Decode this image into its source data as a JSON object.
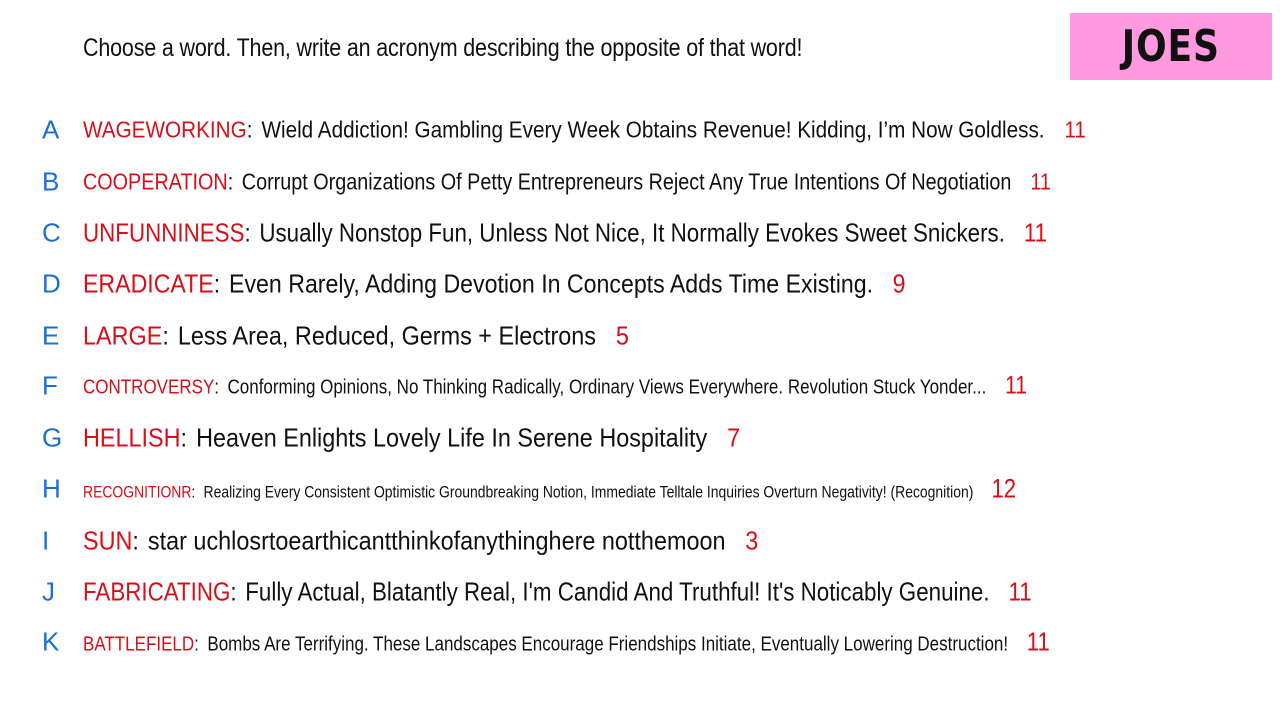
{
  "prompt": "Choose a word. Then, write an acronym describing the opposite of that word!",
  "team": "JOES",
  "rows": [
    {
      "letter": "A",
      "word": "WAGEWORKING",
      "acronym": "Wield Addiction! Gambling Every Week Obtains Revenue! Kidding, I’m Now Goldless.",
      "score": "11"
    },
    {
      "letter": "B",
      "word": "COOPERATION",
      "acronym": "Corrupt Organizations Of Petty Entrepreneurs Reject Any True Intentions Of Negotiation",
      "score": "11"
    },
    {
      "letter": "C",
      "word": "UNFUNNINESS",
      "acronym": "Usually Nonstop Fun, Unless Not Nice, It Normally Evokes Sweet Snickers.",
      "score": "11"
    },
    {
      "letter": "D",
      "word": "ERADICATE",
      "acronym": "Even Rarely, Adding Devotion In Concepts Adds Time Existing.",
      "score": "9"
    },
    {
      "letter": "E",
      "word": "LARGE",
      "acronym": "Less Area, Reduced, Germs + Electrons",
      "score": "5"
    },
    {
      "letter": "F",
      "word": "CONTROVERSY",
      "acronym": "Conforming Opinions, No Thinking Radically, Ordinary Views Everywhere. Revolution Stuck Yonder...",
      "score": "11"
    },
    {
      "letter": "G",
      "word": "HELLISH",
      "acronym": "Heaven Enlights Lovely Life In Serene Hospitality",
      "score": "7"
    },
    {
      "letter": "H",
      "word": "RECOGNITIONR",
      "acronym": "Realizing Every Consistent Optimistic Groundbreaking Notion, Immediate Telltale Inquiries Overturn Negativity! (Recognition)",
      "score": "12"
    },
    {
      "letter": "I",
      "word": "SUN",
      "acronym": "star uchlosrtoearthicantthinkofanythinghere notthemoon",
      "score": "3"
    },
    {
      "letter": "J",
      "word": "FABRICATING",
      "acronym": "Fully Actual, Blatantly Real, I'm Candid And Truthful! It's Noticably Genuine.",
      "score": "11"
    },
    {
      "letter": "K",
      "word": "BATTLEFIELD",
      "acronym": "Bombs Are Terrifying. These Landscapes Encourage Friendships Initiate, Eventually Lowering Destruction!",
      "score": "11"
    }
  ],
  "colors": {
    "word": "#d80f1a",
    "letter": "#1a6fd6",
    "badge": "#ff99e0",
    "text": "#111111"
  }
}
